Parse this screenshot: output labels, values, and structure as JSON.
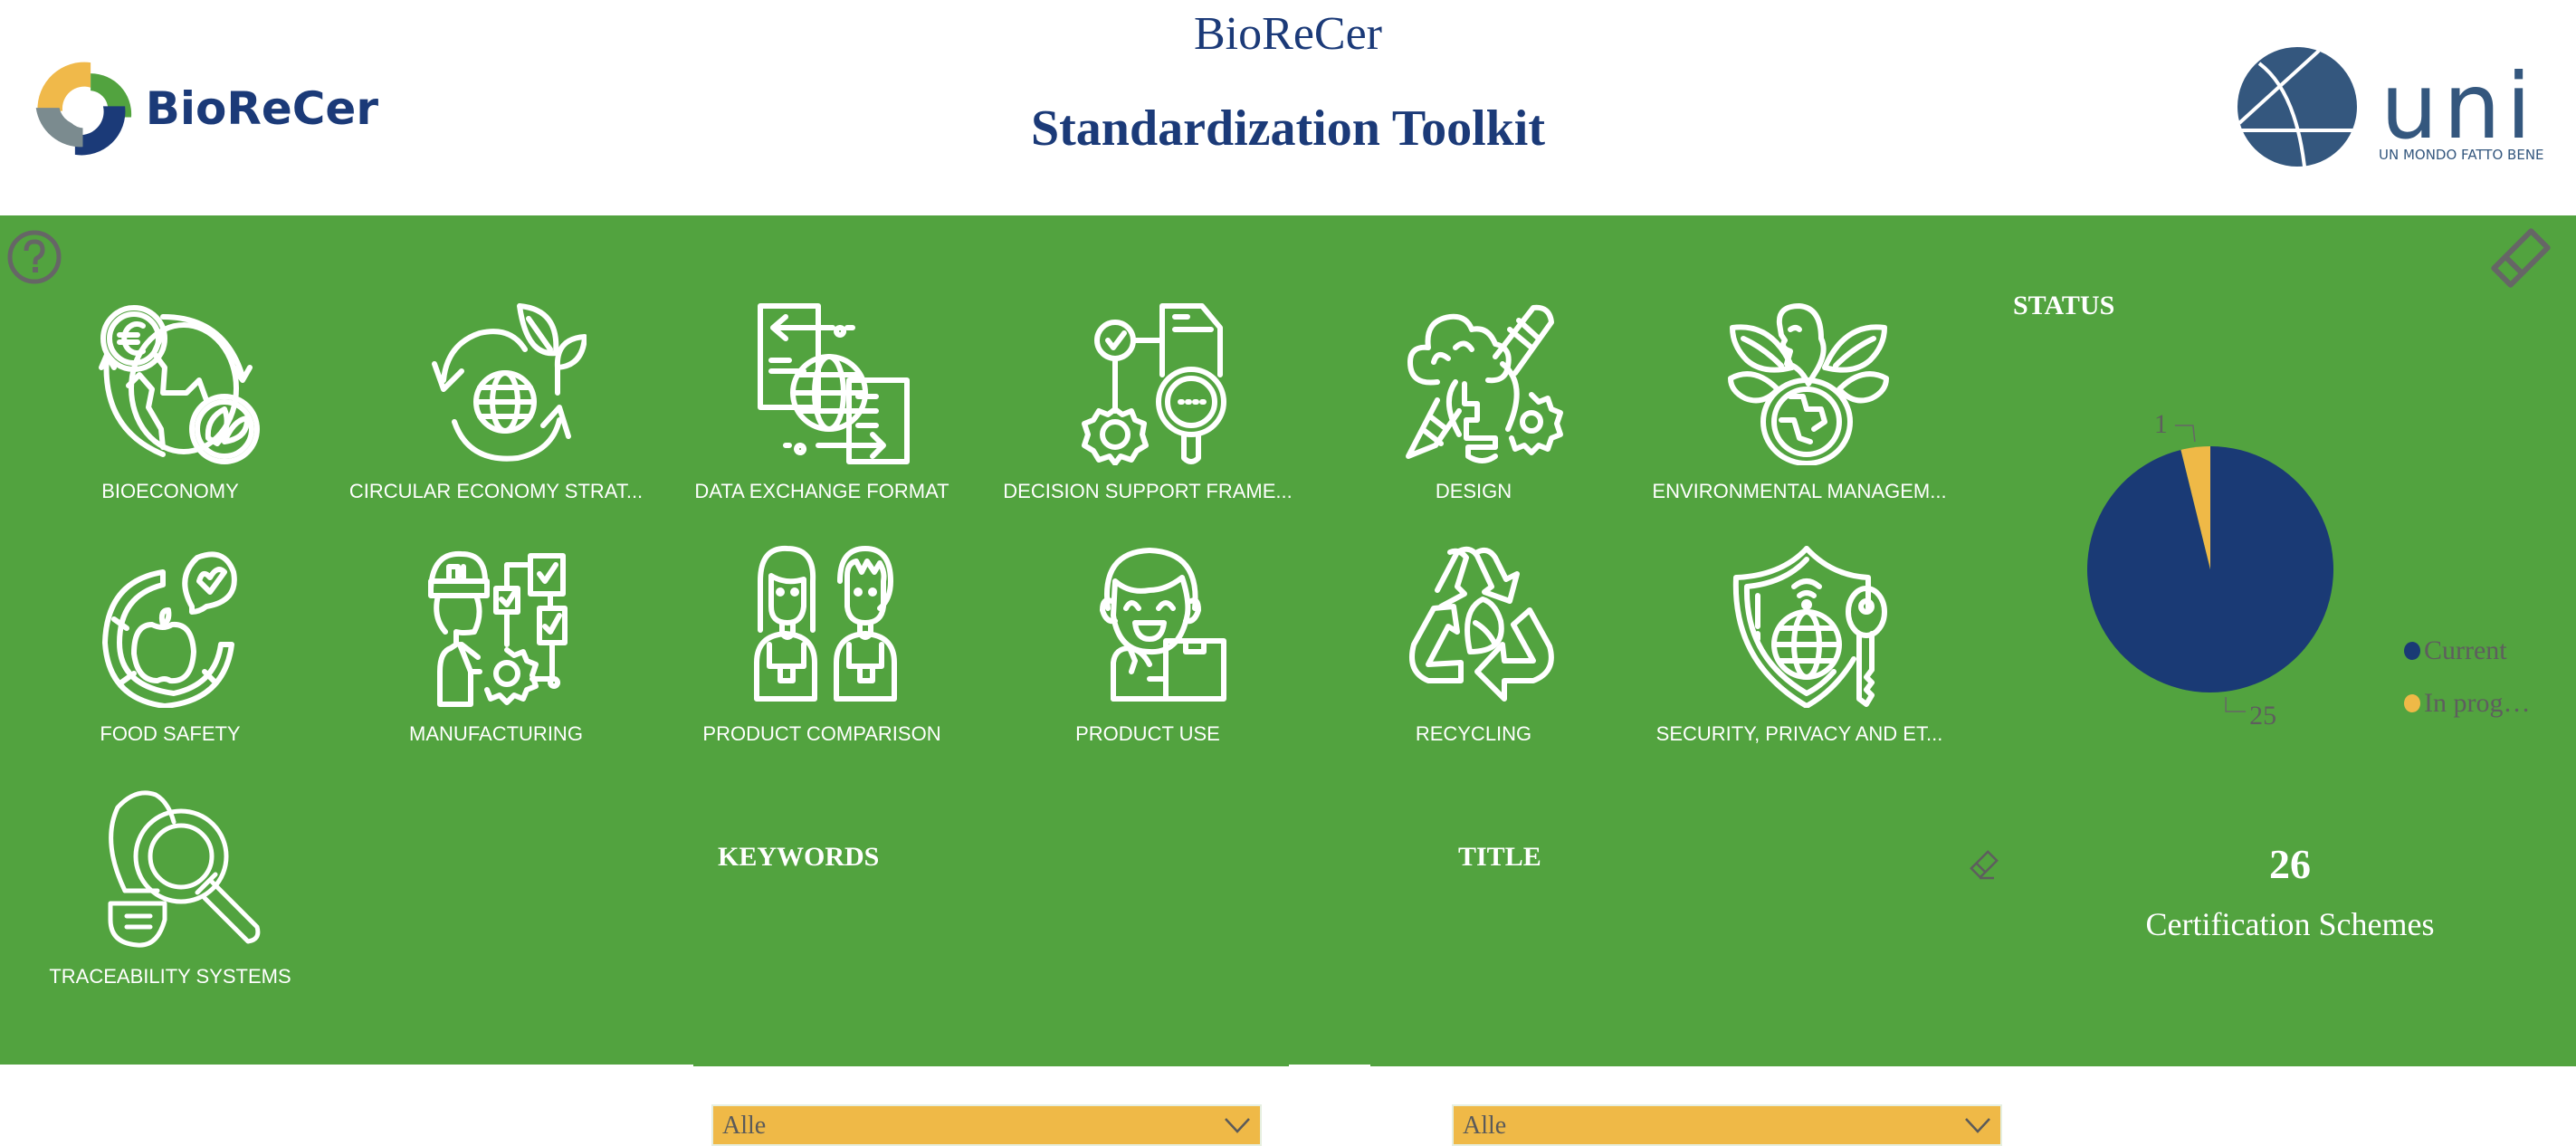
{
  "header": {
    "brand_name": "BioReCer",
    "title_top": "BioReCer",
    "title_main": "Standardization Toolkit",
    "partner_logo_word": "uni",
    "partner_logo_tagline": "UN MONDO FATTO BENE"
  },
  "toolbar": {
    "help_icon": "question-circle-icon",
    "clear_filters_icon": "eraser-icon"
  },
  "categories": [
    {
      "label": "BIOECONOMY",
      "icon": "bioeconomy-globe-euro-icon"
    },
    {
      "label": "CIRCULAR ECONOMY STRAT...",
      "icon": "circular-economy-icon"
    },
    {
      "label": "DATA EXCHANGE FORMAT",
      "icon": "data-exchange-icon"
    },
    {
      "label": "DECISION SUPPORT FRAME...",
      "icon": "decision-support-icon"
    },
    {
      "label": "DESIGN",
      "icon": "design-icon"
    },
    {
      "label": "ENVIRONMENTAL MANAGEM...",
      "icon": "environmental-management-icon"
    },
    {
      "label": "FOOD SAFETY",
      "icon": "food-safety-icon"
    },
    {
      "label": "MANUFACTURING",
      "icon": "manufacturing-icon"
    },
    {
      "label": "PRODUCT COMPARISON",
      "icon": "product-comparison-icon"
    },
    {
      "label": "PRODUCT USE",
      "icon": "product-use-icon"
    },
    {
      "label": "RECYCLING",
      "icon": "recycling-icon"
    },
    {
      "label": "SECURITY, PRIVACY AND ET...",
      "icon": "security-privacy-icon"
    },
    {
      "label": "TRACEABILITY SYSTEMS",
      "icon": "traceability-icon"
    }
  ],
  "filters": {
    "keywords": {
      "label": "KEYWORDS",
      "value": "Alle"
    },
    "title": {
      "label": "TITLE",
      "value": "Alle"
    }
  },
  "status": {
    "title": "STATUS"
  },
  "kpi": {
    "value": "26",
    "label": "Certification Schemes"
  },
  "colors": {
    "green": "#52a33f",
    "navy": "#1a3a75",
    "yellow": "#efb947",
    "grey": "#666666"
  },
  "chart_data": {
    "type": "pie",
    "title": "STATUS",
    "categories": [
      "Current",
      "In prog..."
    ],
    "values": [
      25,
      1
    ],
    "colors": [
      "#1a3a75",
      "#efb947"
    ],
    "data_labels": [
      "25",
      "1"
    ],
    "legend": {
      "position": "right",
      "entries": [
        "Current",
        "In prog…"
      ]
    }
  }
}
